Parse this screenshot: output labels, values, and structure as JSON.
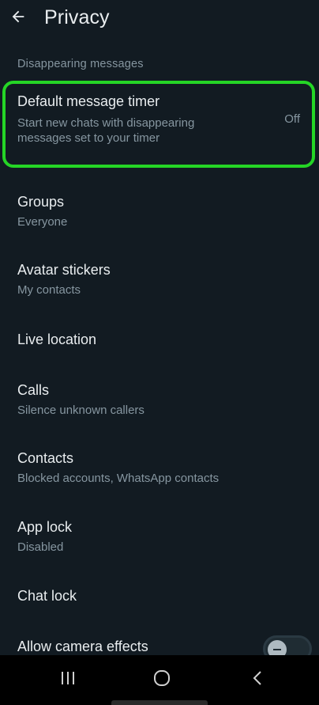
{
  "header": {
    "title": "Privacy",
    "back_icon": "arrow-left-icon"
  },
  "sections": [
    {
      "label": "Disappearing messages"
    }
  ],
  "items": [
    {
      "title": "Default message timer",
      "subtitle_lines": [
        "Start new chats with disappearing",
        "messages set to your timer"
      ],
      "value": "Off"
    },
    {
      "title": "Groups",
      "subtitle": "Everyone"
    },
    {
      "title": "Avatar stickers",
      "subtitle": "My contacts"
    },
    {
      "title": "Live location"
    },
    {
      "title": "Calls",
      "subtitle": "Silence unknown callers"
    },
    {
      "title": "Contacts",
      "subtitle": "Blocked accounts, WhatsApp contacts"
    },
    {
      "title": "App lock",
      "subtitle": "Disabled"
    },
    {
      "title": "Chat lock"
    },
    {
      "title": "Allow camera effects",
      "toggle_on": false
    }
  ],
  "navbar": {
    "icons": [
      "recent-apps-icon",
      "home-icon",
      "back-nav-icon"
    ]
  },
  "colors": {
    "background": "#121b22",
    "primary_text": "#e9edef",
    "secondary_text": "#8696a0",
    "highlight": "#25d526"
  }
}
